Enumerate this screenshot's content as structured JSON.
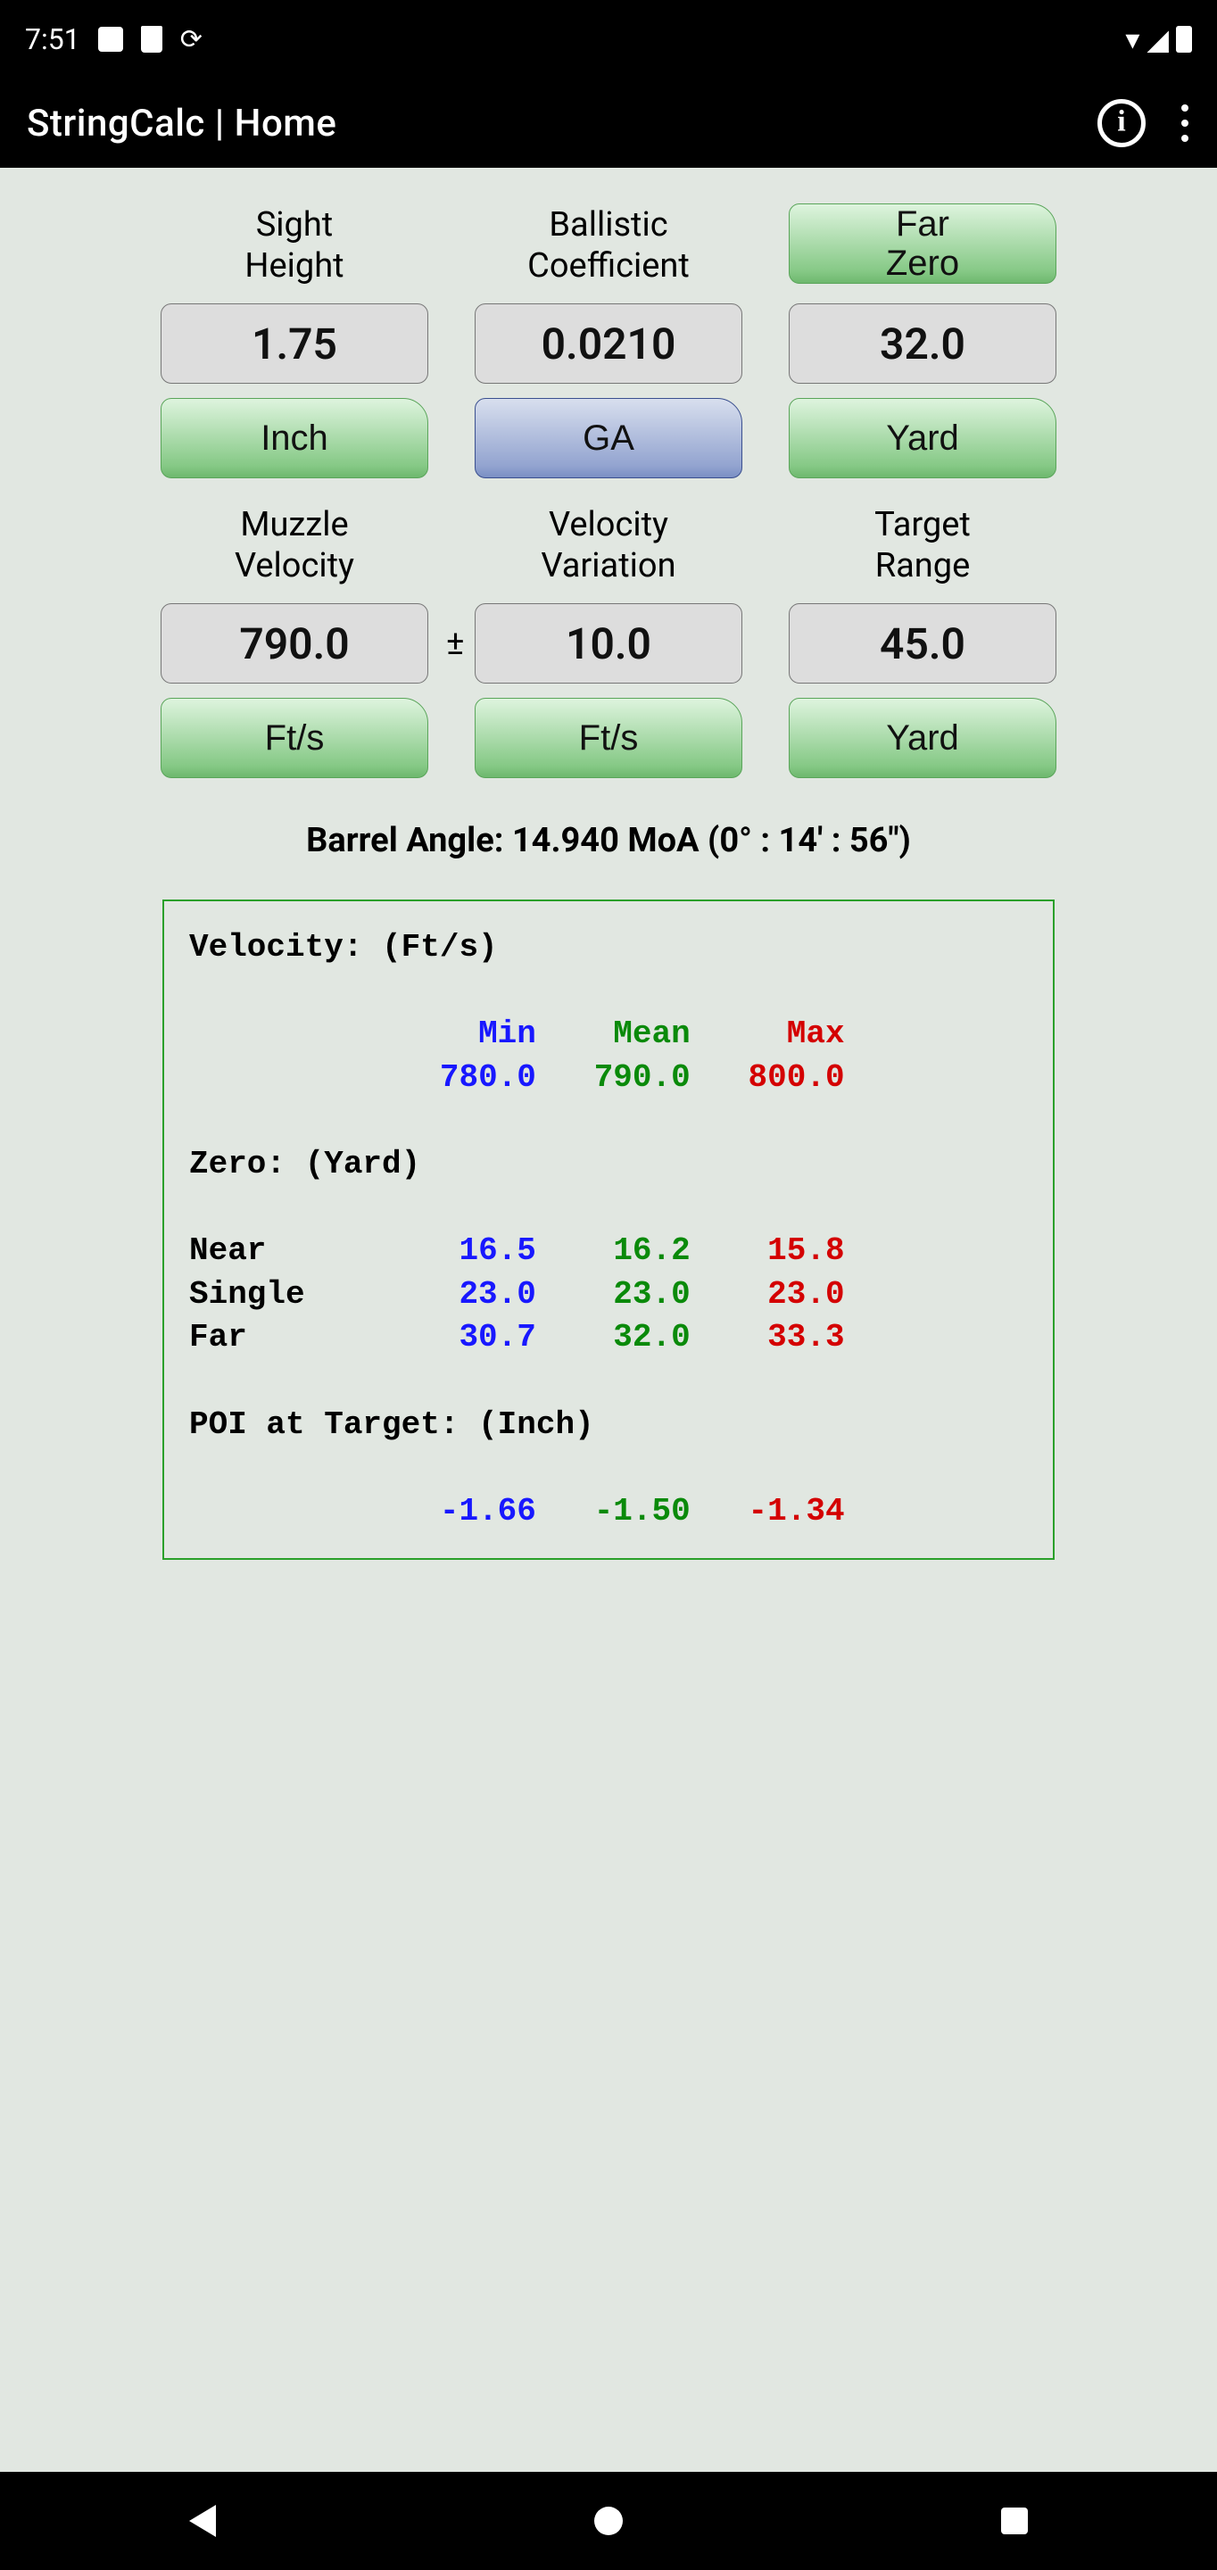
{
  "status": {
    "time": "7:51"
  },
  "appbar": {
    "title": "StringCalc | Home"
  },
  "labels": {
    "sight_height": "Sight\nHeight",
    "ballistic_coef": "Ballistic\nCoefficient",
    "far_zero": "Far\nZero",
    "muzzle_vel": "Muzzle\nVelocity",
    "vel_var": "Velocity\nVariation",
    "target_range": "Target\nRange",
    "pm": "±"
  },
  "values": {
    "sight_height": "1.75",
    "ballistic_coef": "0.0210",
    "far_zero": "32.0",
    "muzzle_vel": "790.0",
    "vel_var": "10.0",
    "target_range": "45.0"
  },
  "units": {
    "sight_height": "Inch",
    "ballistic_coef": "GA",
    "far_zero": "Yard",
    "muzzle_vel": "Ft/s",
    "vel_var": "Ft/s",
    "target_range": "Yard"
  },
  "barrel_angle": "Barrel Angle: 14.940 MoA (0° : 14' : 56\")",
  "results": {
    "velocity_header": "Velocity: (Ft/s)",
    "col_min": "Min",
    "col_mean": "Mean",
    "col_max": "Max",
    "vel_min": "780.0",
    "vel_mean": "790.0",
    "vel_max": "800.0",
    "zero_header": "Zero: (Yard)",
    "near_label": "Near",
    "near_min": "16.5",
    "near_mean": "16.2",
    "near_max": "15.8",
    "single_label": "Single",
    "single_min": "23.0",
    "single_mean": "23.0",
    "single_max": "23.0",
    "far_label": "Far",
    "far_min": "30.7",
    "far_mean": "32.0",
    "far_max": "33.3",
    "poi_header": "POI at Target: (Inch)",
    "poi_min": "-1.66",
    "poi_mean": "-1.50",
    "poi_max": "-1.34"
  }
}
